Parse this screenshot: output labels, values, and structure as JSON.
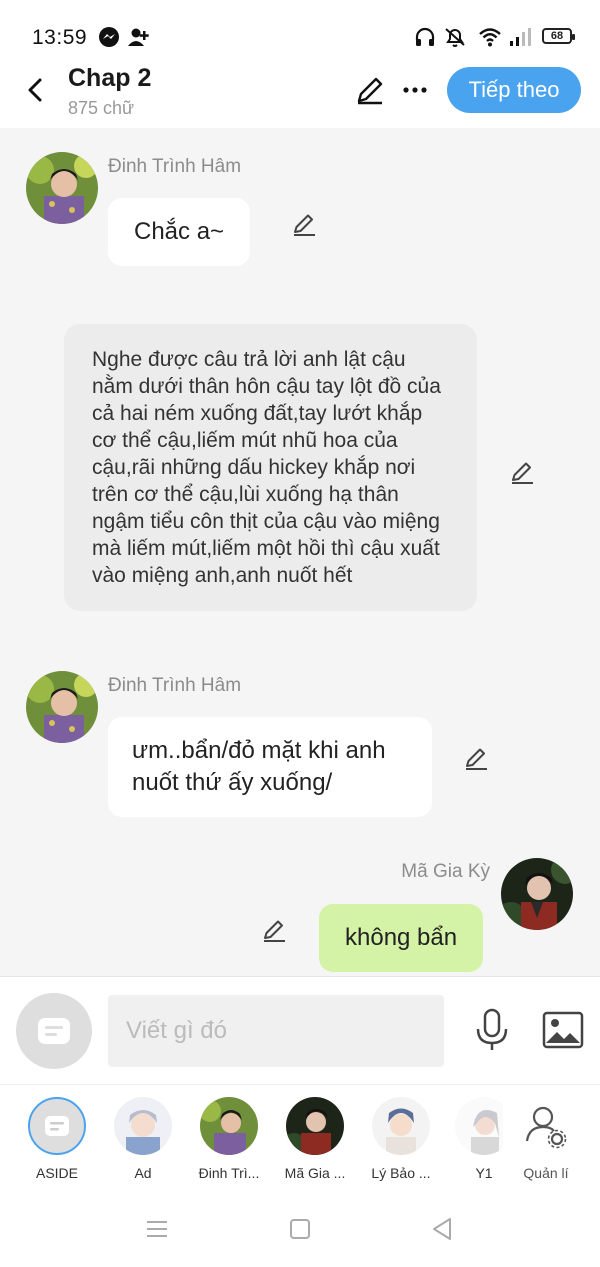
{
  "status_bar": {
    "time": "13:59",
    "battery": "68"
  },
  "header": {
    "title": "Chap 2",
    "subtitle": "875 chữ",
    "next_label": "Tiếp theo"
  },
  "messages": [
    {
      "type": "character",
      "sender": "Đinh Trình Hâm",
      "text": "Chắc a~"
    },
    {
      "type": "narration",
      "text": "Nghe được câu trả lời anh lật cậu nằm dưới thân hôn cậu tay lột đồ của cả hai ném xuống đất,tay lướt khắp cơ thể cậu,liếm mút nhũ hoa của cậu,rãi những dấu hickey khắp nơi trên cơ thể cậu,lùi xuống hạ thân ngậm tiểu côn thịt của cậu vào miệng mà liếm mút,liếm một hồi thì cậu xuất vào miệng anh,anh nuốt hết"
    },
    {
      "type": "character",
      "sender": "Đinh Trình Hâm",
      "text": "ưm..bẩn/đỏ mặt khi anh nuốt thứ ấy xuống/"
    },
    {
      "type": "character",
      "sender": "Mã Gia Kỳ",
      "text": "không bẩn"
    }
  ],
  "composer": {
    "placeholder": "Viết gì đó"
  },
  "characters": [
    {
      "label": "ASIDE"
    },
    {
      "label": "Ad"
    },
    {
      "label": "Đinh Trì..."
    },
    {
      "label": "Mã Gia ..."
    },
    {
      "label": "Lý Bảo ..."
    },
    {
      "label": "Y1"
    },
    {
      "label": "Quản lí"
    }
  ],
  "colors": {
    "accent": "#4aa3ef",
    "my_bubble": "#d5f3a6",
    "narration_bg": "#ececec"
  }
}
